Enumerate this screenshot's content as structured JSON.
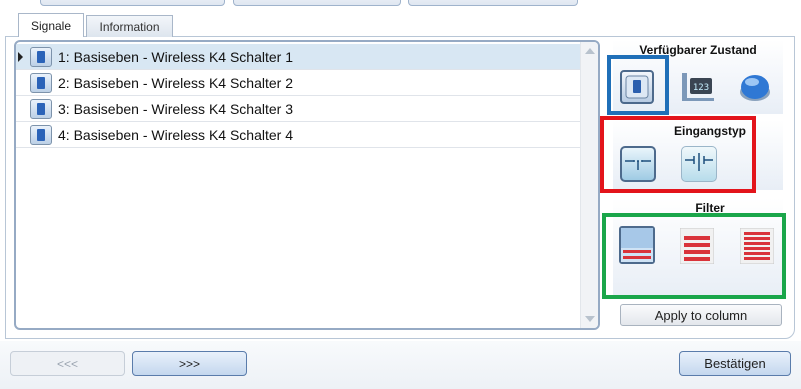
{
  "tabs": [
    {
      "label": "Signale",
      "active": true
    },
    {
      "label": "Information",
      "active": false
    }
  ],
  "signals": [
    {
      "label": "1: Basiseben - Wireless K4 Schalter 1",
      "selected": true
    },
    {
      "label": "2: Basiseben - Wireless K4 Schalter 2",
      "selected": false
    },
    {
      "label": "3: Basiseben - Wireless K4 Schalter 3",
      "selected": false
    },
    {
      "label": "4: Basiseben - Wireless K4 Schalter 4",
      "selected": false
    }
  ],
  "sections": {
    "state_title": "Verfügbarer Zustand",
    "input_title": "Eingangstyp",
    "filter_title": "Filter"
  },
  "icons": {
    "state": [
      "switch-state-icon",
      "display-value-icon",
      "push-button-icon"
    ],
    "input": [
      "normally-open-contact-icon",
      "normally-closed-contact-icon"
    ],
    "filter": [
      "filter-blue-icon",
      "filter-red-icon",
      "filter-red-dense-icon"
    ]
  },
  "highlight_colors": {
    "state": "#1f6fb8",
    "input": "#e3141b",
    "filter": "#1aa64a"
  },
  "buttons": {
    "apply_to_column": "Apply to column",
    "prev": "<<<",
    "next": ">>>",
    "confirm": "Bestätigen"
  }
}
